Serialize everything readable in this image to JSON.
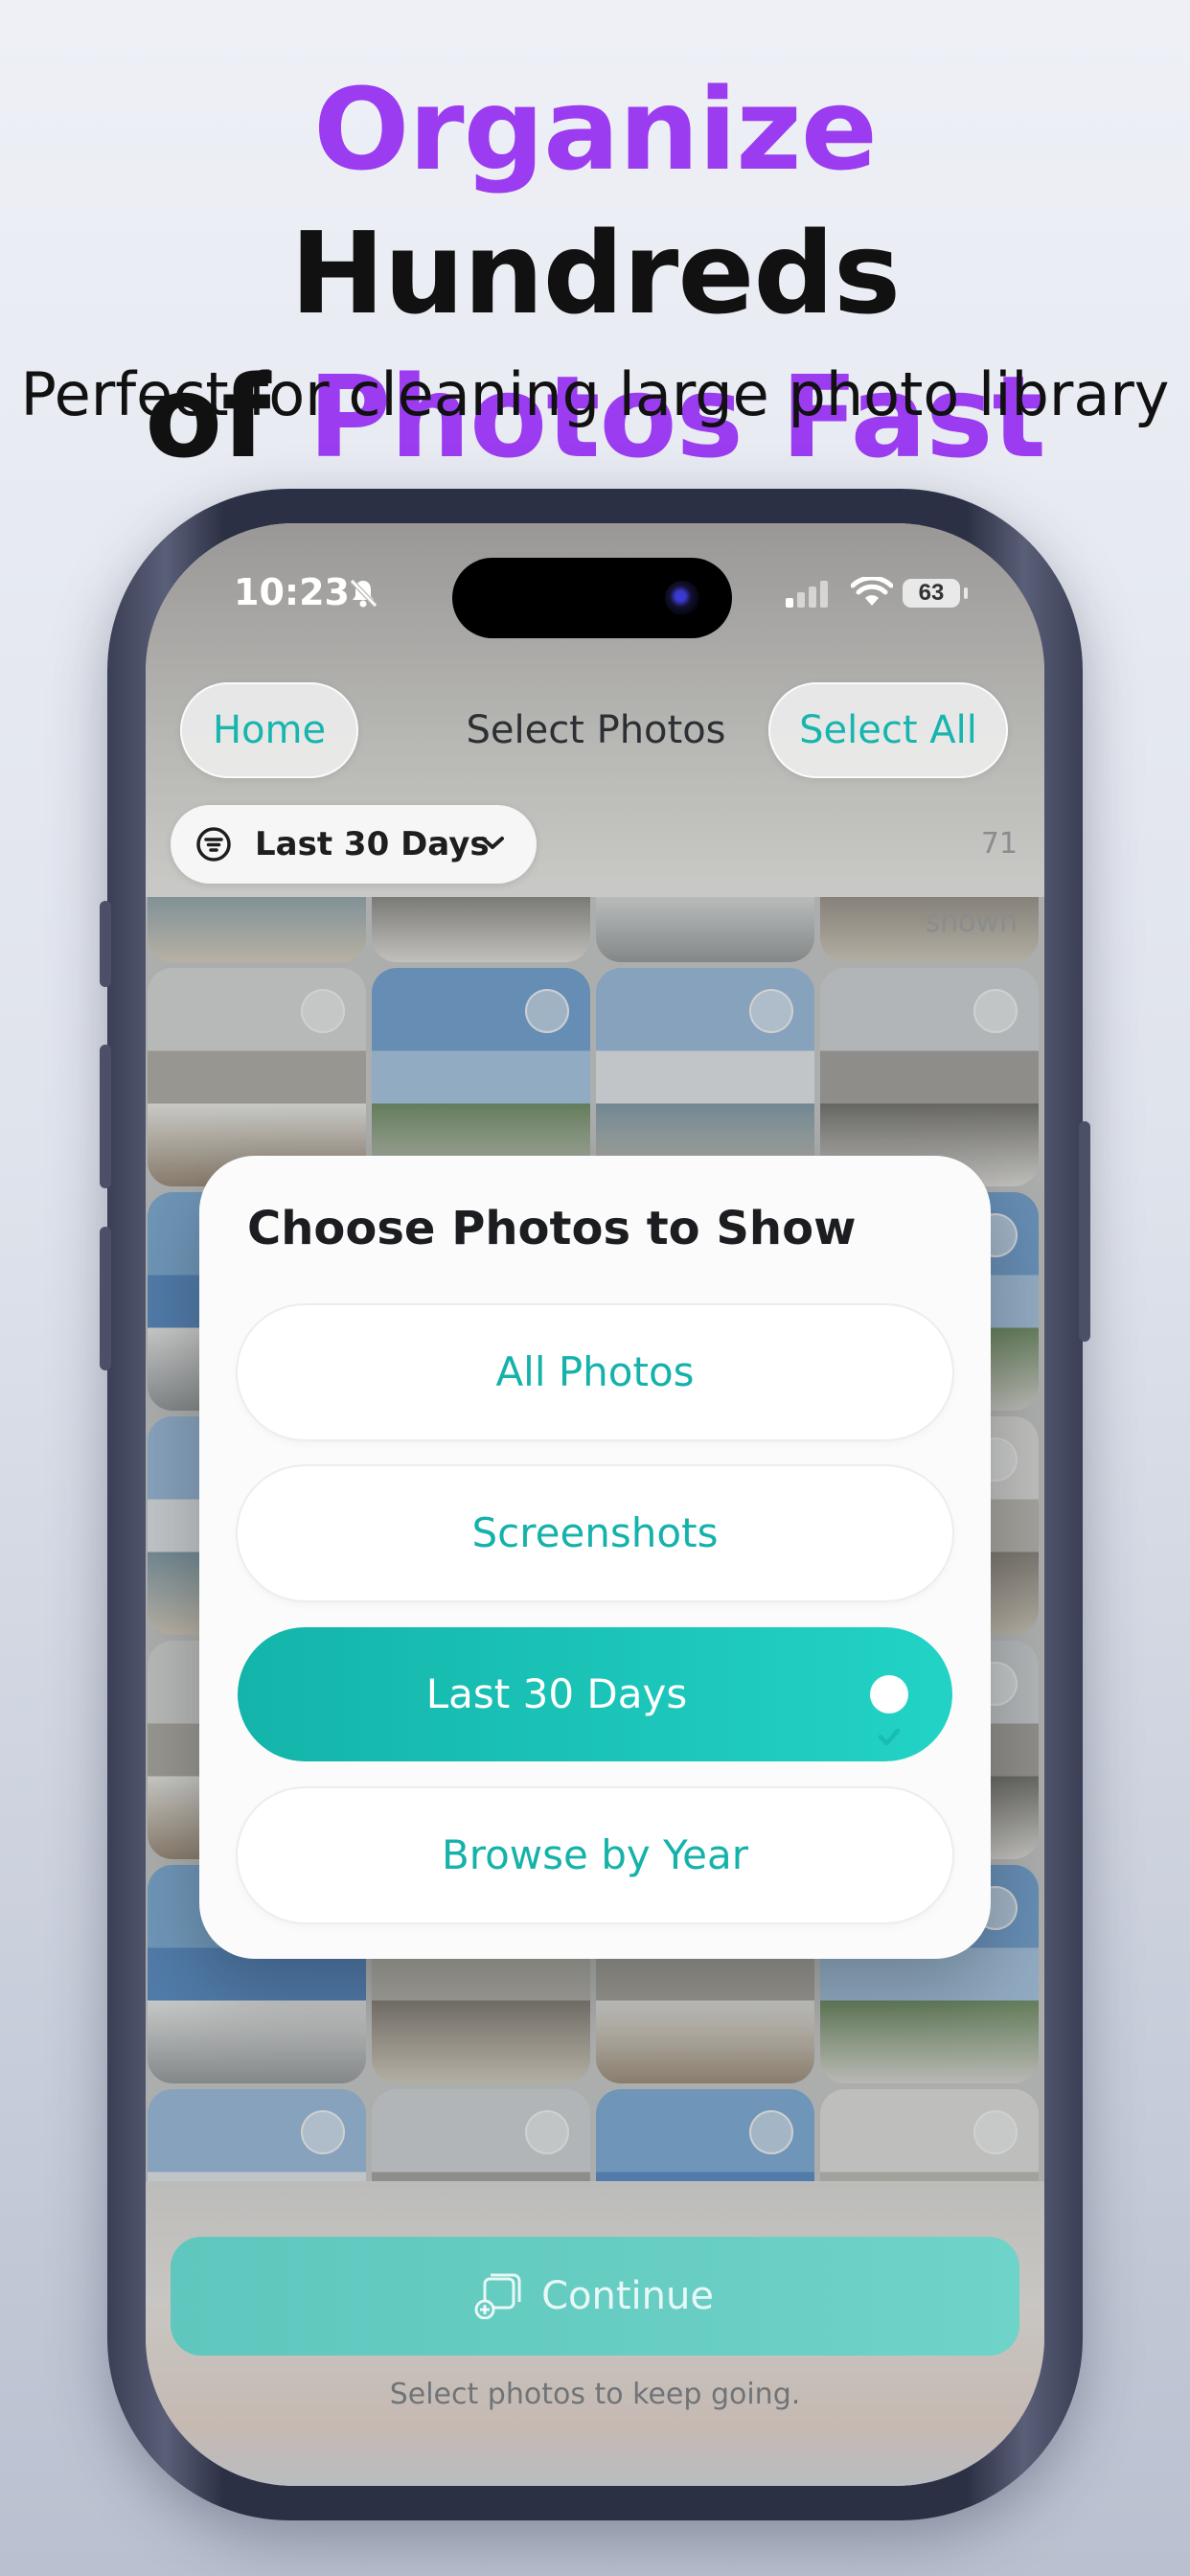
{
  "promo": {
    "headline_line1_accent": "Organize",
    "headline_line1_rest": " Hundreds",
    "headline_line2_start": "of ",
    "headline_line2_accent": "Photos Fast",
    "subheadline": "Perfect for cleaning large photo library"
  },
  "status_bar": {
    "time": "10:23",
    "battery": "63"
  },
  "nav": {
    "home_label": "Home",
    "title": "Select Photos",
    "select_all_label": "Select All"
  },
  "filter": {
    "current_label": "Last 30 Days",
    "shown_count": "71 shown"
  },
  "modal": {
    "title": "Choose Photos to Show",
    "options": [
      {
        "label": "All Photos",
        "selected": false
      },
      {
        "label": "Screenshots",
        "selected": false
      },
      {
        "label": "Last 30 Days",
        "selected": true
      },
      {
        "label": "Browse by Year",
        "selected": false
      }
    ]
  },
  "footer": {
    "continue_label": "Continue",
    "hint": "Select photos to keep going."
  },
  "colors": {
    "accent_purple": "#9b3cf0",
    "teal": "#16b5ad"
  },
  "icons": [
    "bell-slash-icon",
    "signal-icon",
    "wifi-icon",
    "filter-icon",
    "chevron-down-icon",
    "checkmark-icon",
    "photo-stack-add-icon"
  ]
}
